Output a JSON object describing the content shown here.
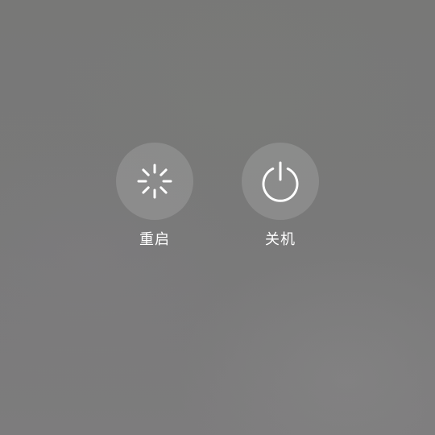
{
  "power_menu": {
    "restart": {
      "label": "重启",
      "icon": "restart-spinner-icon"
    },
    "shutdown": {
      "label": "关机",
      "icon": "power-icon"
    }
  },
  "colors": {
    "background": "#797979",
    "button_fill": "rgba(255,255,255,0.14)",
    "foreground": "#ffffff"
  }
}
